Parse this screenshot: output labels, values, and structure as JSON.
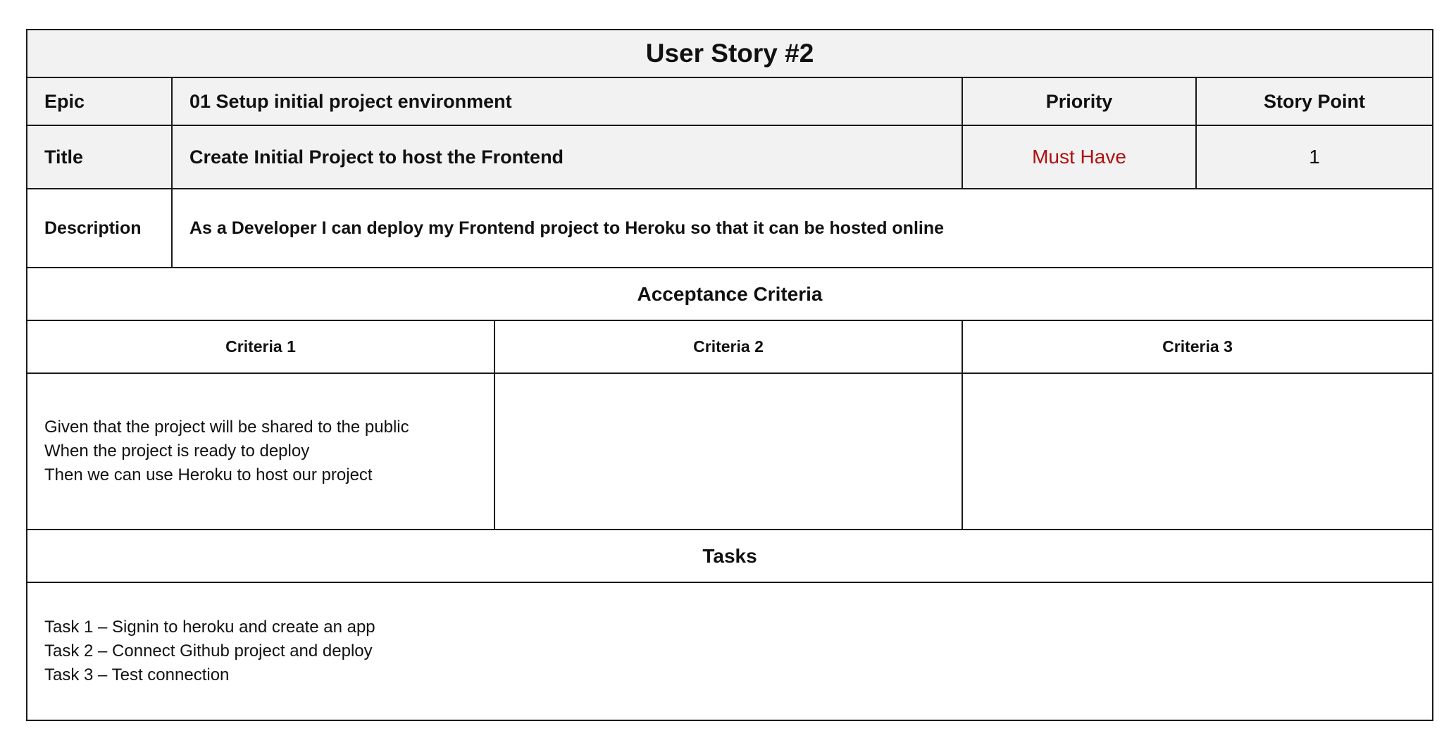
{
  "story": {
    "heading": "User Story #2",
    "epic_label": "Epic",
    "epic_value": "01 Setup initial project environment",
    "priority_label": "Priority",
    "story_point_label": "Story Point",
    "title_label": "Title",
    "title_value": "Create Initial Project to host the Frontend",
    "priority_value": "Must Have",
    "story_point_value": "1",
    "description_label": "Description",
    "description_value": "As a Developer I can deploy my Frontend project to Heroku so that it can be hosted online",
    "acceptance_heading": "Acceptance Criteria",
    "criteria": [
      {
        "label": "Criteria 1",
        "lines": [
          "Given that the project will be shared to the public",
          "When the project is ready to deploy",
          "Then we can use Heroku to host our project"
        ]
      },
      {
        "label": "Criteria 2",
        "lines": []
      },
      {
        "label": "Criteria 3",
        "lines": []
      }
    ],
    "tasks_heading": "Tasks",
    "tasks": [
      "Task 1 – Signin to heroku and create an app",
      "Task 2 – Connect Github project and deploy",
      "Task 3 – Test connection"
    ]
  },
  "colors": {
    "header_background": "#f2f2f2",
    "border": "#1a1a1a",
    "priority_text": "#b01010"
  }
}
